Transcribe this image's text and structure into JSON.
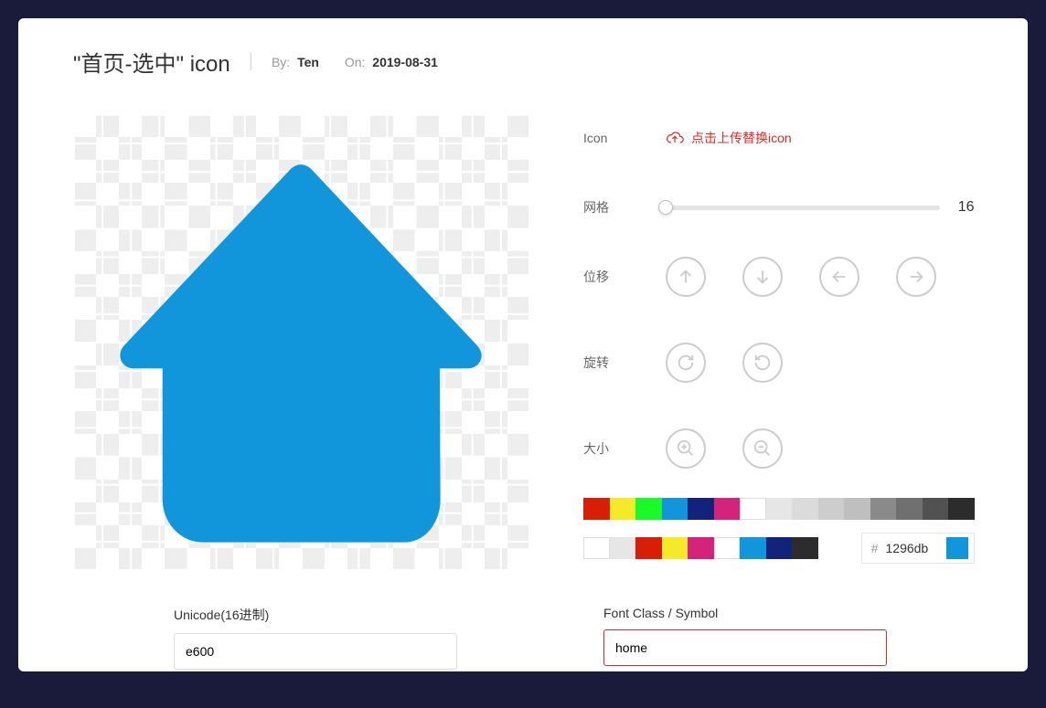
{
  "header": {
    "title": "\"首页-选中\" icon",
    "by_label": "By:",
    "author": "Ten",
    "on_label": "On:",
    "date": "2019-08-31"
  },
  "controls": {
    "icon_label": "Icon",
    "upload_text": "点击上传替换icon",
    "grid_label": "网格",
    "grid_value": "16",
    "translate_label": "位移",
    "rotate_label": "旋转",
    "size_label": "大小"
  },
  "palette1": [
    "#d81e06",
    "#f4ea2a",
    "#1afa29",
    "#1296db",
    "#13227a",
    "#d4237a",
    "#ffffff",
    "#e6e6e6",
    "#dbdbdb",
    "#cdcdcd",
    "#bfbfbf",
    "#8a8a8a",
    "#707070",
    "#515151",
    "#2c2c2c"
  ],
  "palette2": [
    "#ffffff",
    "#e6e6e6",
    "#d81e06",
    "#f4ea2a",
    "#d4237a",
    "#ffffff",
    "#1296db",
    "#13227a",
    "#2c2c2c"
  ],
  "hex": {
    "prefix": "#",
    "value": "1296db",
    "color": "#1296db"
  },
  "icon_color": "#1296db",
  "fields": {
    "unicode_label": "Unicode(16进制)",
    "unicode_value": "e600",
    "fontclass_label": "Font Class / Symbol",
    "fontclass_value": "home"
  }
}
